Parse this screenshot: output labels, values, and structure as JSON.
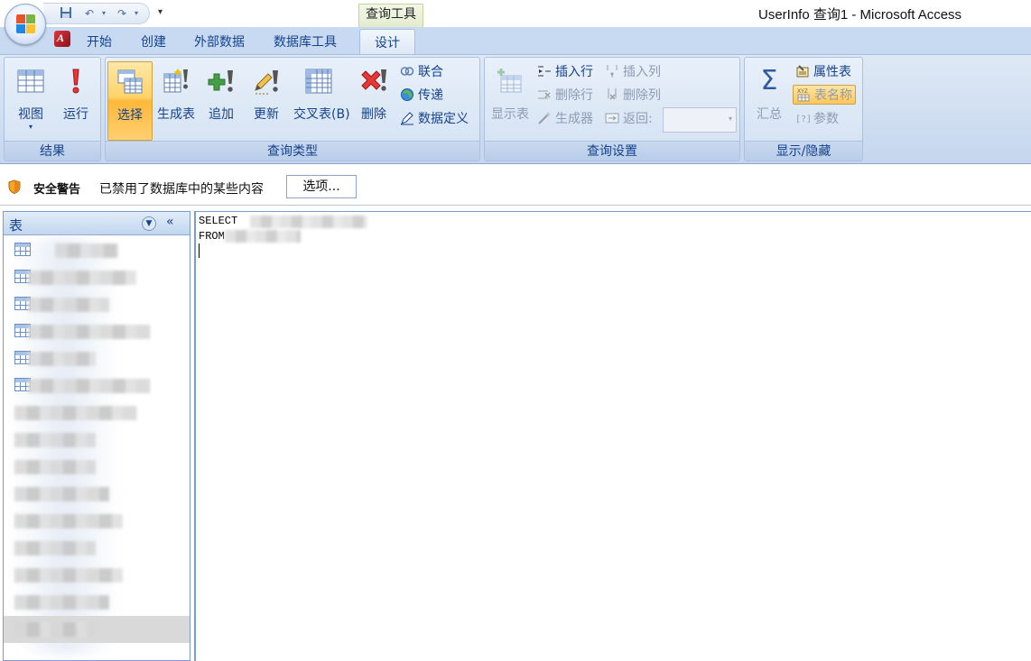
{
  "window": {
    "title": "UserInfo 查询1 - Microsoft Access",
    "context_tab_group": "查询工具"
  },
  "quick_access": {
    "icons": [
      "save-icon",
      "undo-icon",
      "redo-icon",
      "customize-qat-icon"
    ]
  },
  "tabs": [
    {
      "label": "开始",
      "active": false
    },
    {
      "label": "创建",
      "active": false
    },
    {
      "label": "外部数据",
      "active": false
    },
    {
      "label": "数据库工具",
      "active": false
    },
    {
      "label": "设计",
      "active": true
    }
  ],
  "ribbon": {
    "groups": {
      "results": {
        "label": "结果",
        "view": "视图",
        "run": "运行"
      },
      "query_type": {
        "label": "查询类型",
        "select": "选择",
        "make_table": "生成表",
        "append": "追加",
        "update": "更新",
        "crosstab": "交叉表(B)",
        "delete": "删除",
        "union": "联合",
        "pass_through": "传递",
        "data_definition": "数据定义"
      },
      "query_setup": {
        "label": "查询设置",
        "show_table": "显示表",
        "insert_rows": "插入行",
        "delete_rows": "删除行",
        "builder": "生成器",
        "insert_columns": "插入列",
        "delete_columns": "删除列",
        "return_label": "返回:",
        "return_value": ""
      },
      "show_hide": {
        "label": "显示/隐藏",
        "totals": "汇总",
        "property_sheet": "属性表",
        "table_names": "表名称",
        "parameters": "参数"
      }
    }
  },
  "security_bar": {
    "title": "安全警告",
    "message": "已禁用了数据库中的某些内容",
    "options_button": "选项..."
  },
  "nav_pane": {
    "title": "表",
    "collapse_glyph": "«",
    "item_count": 15
  },
  "sql_editor": {
    "lines": [
      "SELECT",
      "FROM"
    ]
  }
}
